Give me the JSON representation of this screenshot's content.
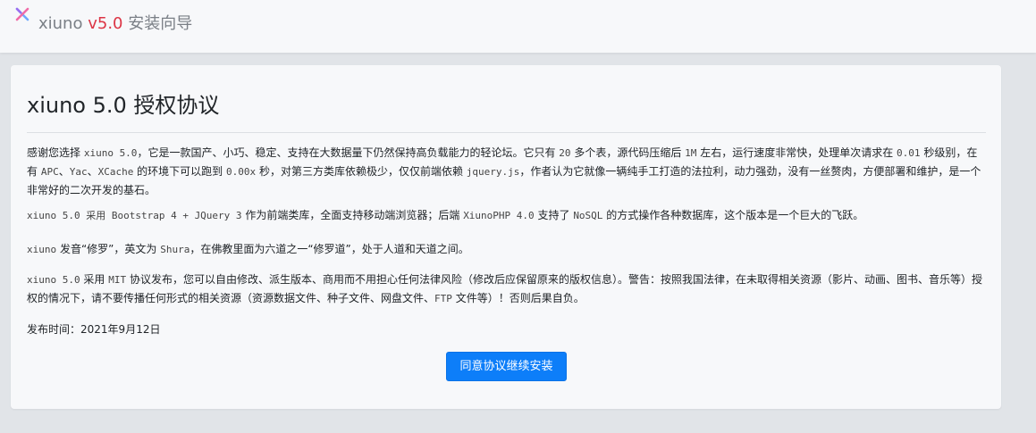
{
  "header": {
    "logo_icon": "cross-logo-icon",
    "brand_name": "xiuno",
    "brand_version": "v5.0",
    "brand_suffix": "安装向导",
    "accent_color": "#dc3545"
  },
  "card": {
    "title": "xiuno 5.0 授权协议",
    "paragraphs": {
      "intro": [
        "感谢您选择 ",
        "xiuno 5.0",
        "，它是一款国产、小巧、稳定、支持在大数据量下仍然保持高负载能力的轻论坛。它只有 ",
        "20",
        " 多个表，源代码压缩后 ",
        "1M",
        " 左右，运行速度非常快，处理单次请求在 ",
        "0.01",
        " 秒级别，在有 ",
        "APC",
        "、",
        "Yac",
        "、",
        "XCache",
        " 的环境下可以跑到 ",
        "0.00x",
        " 秒，对第三方类库依赖极少，仅仅前端依赖 ",
        "jquery.js",
        "，作者认为它就像一辆纯手工打造的法拉利，动力强劲，没有一丝赘肉，方便部署和维护，是一个非常好的二次开发的基石。"
      ],
      "stack": [
        "xiuno 5.0 采用 Bootstrap 4 + JQuery 3",
        " 作为前端类库，全面支持移动端浏览器；后端 ",
        "XiunoPHP 4.0",
        " 支持了 ",
        "NoSQL",
        " 的方式操作各种数据库，这个版本是一个巨大的飞跃。"
      ],
      "name": [
        "xiuno",
        " 发音“修罗”，英文为 ",
        "Shura",
        "，在佛教里面为六道之一“修罗道”，处于人道和天道之间。"
      ],
      "license": [
        "xiuno 5.0",
        " 采用 ",
        "MIT",
        " 协议发布，您可以自由修改、派生版本、商用而不用担心任何法律风险（修改后应保留原来的版权信息）。警告：按照我国法律，在未取得相关资源（影片、动画、图书、音乐等）授权的情况下，请不要传播任何形式的相关资源（资源数据文件、种子文件、网盘文件、",
        "FTP",
        " 文件等）！否则后果自负。"
      ],
      "release_label": "发布时间：",
      "release_date": "2021年9月12日"
    },
    "agree_button": "同意协议继续安装",
    "button_color": "#0d7ef9"
  }
}
